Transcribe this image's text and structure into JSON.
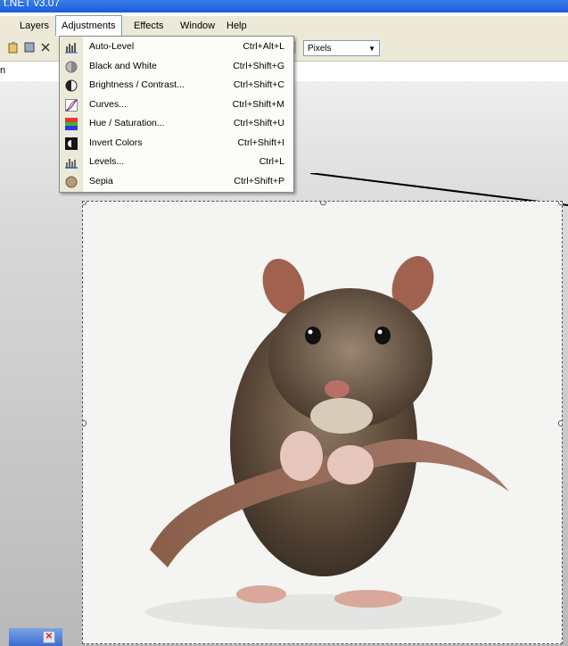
{
  "window": {
    "app_title_fragment": "t.NET v3.07"
  },
  "menubar": {
    "items": [
      {
        "id": "layers",
        "label": "Layers"
      },
      {
        "id": "adjustments",
        "label": "Adjustments"
      },
      {
        "id": "effects",
        "label": "Effects"
      },
      {
        "id": "window",
        "label": "Window"
      },
      {
        "id": "help",
        "label": "Help"
      }
    ]
  },
  "toolbar": {
    "units_value": "Pixels"
  },
  "strip": {
    "label": "n"
  },
  "adjustments_menu": {
    "items": [
      {
        "label": "Auto-Level",
        "shortcut": "Ctrl+Alt+L",
        "icon": "auto-level-icon"
      },
      {
        "label": "Black and White",
        "shortcut": "Ctrl+Shift+G",
        "icon": "black-and-white-icon"
      },
      {
        "label": "Brightness / Contrast...",
        "shortcut": "Ctrl+Shift+C",
        "icon": "brightness-contrast-icon"
      },
      {
        "label": "Curves...",
        "shortcut": "Ctrl+Shift+M",
        "icon": "curves-icon"
      },
      {
        "label": "Hue / Saturation...",
        "shortcut": "Ctrl+Shift+U",
        "icon": "hue-saturation-icon"
      },
      {
        "label": "Invert Colors",
        "shortcut": "Ctrl+Shift+I",
        "icon": "invert-colors-icon"
      },
      {
        "label": "Levels...",
        "shortcut": "Ctrl+L",
        "icon": "levels-icon"
      },
      {
        "label": "Sepia",
        "shortcut": "Ctrl+Shift+P",
        "icon": "sepia-icon"
      }
    ]
  },
  "colors": {
    "menu_background": "#ece9d8",
    "titlebar_blue": "#1a5ad9",
    "canvas_background": "#f4f4f3"
  }
}
